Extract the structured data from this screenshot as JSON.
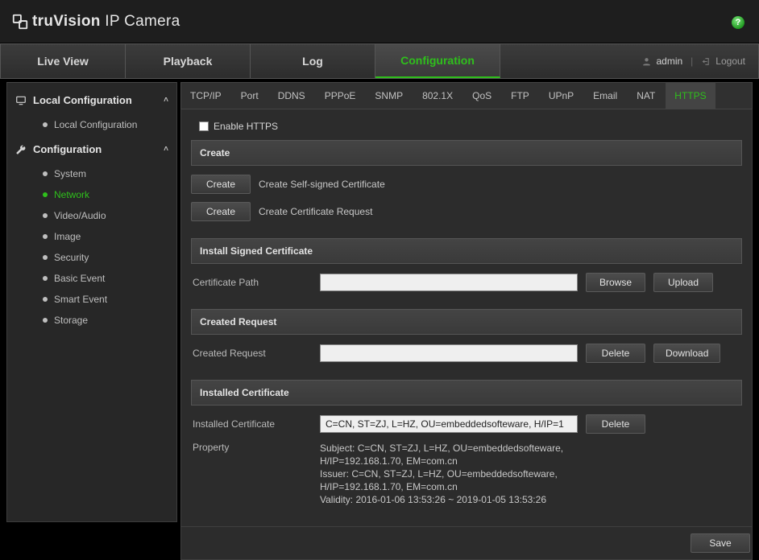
{
  "brand": {
    "bold": "truVision",
    "rest": "  IP Camera"
  },
  "help_glyph": "?",
  "nav": {
    "tabs": [
      "Live View",
      "Playback",
      "Log",
      "Configuration"
    ],
    "active_index": 3,
    "user": "admin",
    "logout": "Logout"
  },
  "sidebar": {
    "groups": [
      {
        "label": "Local Configuration",
        "items": [
          "Local Configuration"
        ],
        "active": null
      },
      {
        "label": "Configuration",
        "items": [
          "System",
          "Network",
          "Video/Audio",
          "Image",
          "Security",
          "Basic Event",
          "Smart Event",
          "Storage"
        ],
        "active": 1
      }
    ]
  },
  "subtabs": {
    "items": [
      "TCP/IP",
      "Port",
      "DDNS",
      "PPPoE",
      "SNMP",
      "802.1X",
      "QoS",
      "FTP",
      "UPnP",
      "Email",
      "NAT",
      "HTTPS"
    ],
    "active_index": 11
  },
  "https": {
    "enable_label": "Enable  HTTPS",
    "create_hdr": "Create",
    "create1_btn": "Create",
    "create1_desc": "Create Self-signed Certificate",
    "create2_btn": "Create",
    "create2_desc": "Create Certificate Request",
    "install_hdr": "Install Signed Certificate",
    "certpath_label": "Certificate Path",
    "certpath_value": "",
    "browse_btn": "Browse",
    "upload_btn": "Upload",
    "created_req_hdr": "Created Request",
    "created_req_label": "Created Request",
    "created_req_value": "",
    "delete_btn": "Delete",
    "download_btn": "Download",
    "installed_hdr": "Installed Certificate",
    "installed_label": "Installed Certificate",
    "installed_value": "C=CN, ST=ZJ, L=HZ, OU=embeddedsofteware, H/IP=1",
    "delete2_btn": "Delete",
    "property_label": "Property",
    "property_lines": [
      "Subject: C=CN, ST=ZJ, L=HZ, OU=embeddedsofteware,",
      "H/IP=192.168.1.70, EM=com.cn",
      "Issuer: C=CN, ST=ZJ, L=HZ, OU=embeddedsofteware,",
      "H/IP=192.168.1.70, EM=com.cn",
      "Validity: 2016-01-06 13:53:26 ~ 2019-01-05 13:53:26"
    ],
    "save_btn": "Save"
  }
}
